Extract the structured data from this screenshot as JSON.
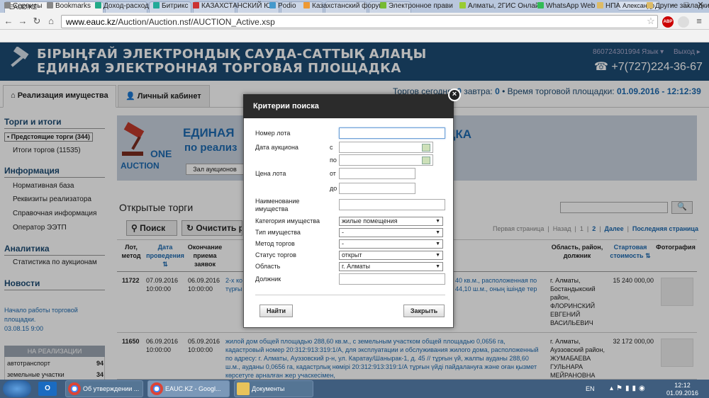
{
  "browser": {
    "tabs": [
      {
        "label": "EAUC.KZ",
        "active": true
      },
      {
        "label": ""
      },
      {
        "label": ""
      },
      {
        "label": ""
      },
      {
        "label": ""
      },
      {
        "label": ""
      },
      {
        "label": ""
      },
      {
        "label": ""
      }
    ],
    "user": "Александр",
    "url_prefix": "www.eauc.kz",
    "url_path": "/Auction/Auction.nsf/AUCTION_Active.xsp",
    "bookmarks": [
      "Сервисы",
      "Bookmarks",
      "Доход-расход",
      "Битрикс",
      "КАЗАХСТАНСКИЙ Ю",
      "Podio",
      "Казахстанский форум",
      "Электронное прави",
      "Алматы, 2ГИС Онлай",
      "WhatsApp Web",
      "НПА",
      "Другие закладки"
    ],
    "abp_badge": "ABP"
  },
  "header": {
    "title_kz": "БІРЫҢҒАЙ ЭЛЕКТРОНДЫҚ САУДА-САТТЫҚ АЛАҢЫ",
    "title_ru": "ЕДИНАЯ ЭЛЕКТРОННАЯ ТОРГОВАЯ ПЛОЩАДКА",
    "account": "860724301994",
    "lang": "Язык",
    "exit": "Выход",
    "phone": "+7(727)224-36-67"
  },
  "nav": {
    "tab1": "Реализация имущества",
    "tab2": "Личный кабинет",
    "today_prefix": "Торгов сегодня: ",
    "today_count": "0",
    "tomorrow_label": " завтра: ",
    "tomorrow_count": "0",
    "time_label": " • Время торговой площадки: ",
    "time_value": "01.09.2016 - 12:12:39"
  },
  "sidebar": {
    "h_trade": "Торги и итоги",
    "upcoming": "• Предстоящие торги (344)",
    "results": "Итоги торгов (11535)",
    "h_info": "Информация",
    "info_items": [
      "Нормативная база",
      "Реквизиты реализатора",
      "Справочная информация",
      "Оператор ЭЭТП"
    ],
    "h_analytics": "Аналитика",
    "stats": "Статистика по аукционам",
    "h_news": "Новости",
    "news_text": "Начало работы торговой площадки.",
    "news_date": "03.08.15 9:00",
    "table_title": "НА РЕАЛИЗАЦИИ",
    "table_rows": [
      {
        "name": "автотранспорт",
        "count": "94"
      },
      {
        "name": "земельные участки",
        "count": "34"
      }
    ]
  },
  "banner": {
    "line1": "ЕДИНАЯ",
    "line2": "по реализ",
    "line3": "ЩАДКА",
    "logo_text": "ONE AUCTION",
    "hall_button": "Зал аукционов"
  },
  "main": {
    "title": "Открытые торги",
    "search_btn": "Поиск",
    "clear_btn": "Очистить р",
    "pager": {
      "first": "Первая страница",
      "back": "Назад",
      "p1": "1",
      "p2": "2",
      "next": "Далее",
      "last": "Последняя страница"
    },
    "columns": {
      "lot": "Лот, метод",
      "date": "Дата проведения",
      "end": "Окончание приема заявок",
      "region": "Область, район, должник",
      "price": "Стартовая стоимость",
      "photo": "Фотография"
    },
    "rows": [
      {
        "lot": "11722",
        "date": "07.09.2016 10:00:00",
        "end": "06.09.2016 10:00:00",
        "desc": "2-х ко",
        "desc_right": "40 кв.м., расположенная по 44,10 ш.м., оның ішінде тер",
        "region": "г. Алматы, Бостандыкский район, ФЛОРИНСКИЙ ЕВГЕНИЙ ВАСИЛЬЕВИЧ",
        "price": "15 240 000,00",
        "desc_line2": "түрғы"
      },
      {
        "lot": "11650",
        "date": "06.09.2016 10:00:00",
        "end": "05.09.2016 10:00:00",
        "desc": "жилой дом общей площадью 288,60 кв.м., с земельным участком общей площадью 0,0656 га, кадастровый номер 20:312:913:319:1/А, для эксплуатации и обслуживания жилого дома, расположенный по адресу: г. Алматы, Ауэзовский р-н, ул. Каратау/Шанырак-1, д. 45 // тұрғын үй, жалпы ауданы 288,60 ш.м., ауданы 0,0656 га, кадастрлық нөмірі 20:312:913:319:1/А тұрғын үйді пайдалануға және оған қызмет көрсетуге арналған жер учаскесімен,",
        "region": "г. Алматы, Ауэзовский район, ЖУМАБАЕВА ГУЛЬНАРА МЕЙРАНОВНА",
        "price": "32 172 000,00"
      }
    ]
  },
  "modal": {
    "title": "Критерии поиска",
    "lot_number": "Номер лота",
    "auction_date": "Дата аукциона",
    "from": "с",
    "to": "по",
    "lot_price": "Цена лота",
    "price_from": "от",
    "price_to": "до",
    "property_name": "Наименование имущества",
    "category": "Категория имущества",
    "category_value": "жилые помещения",
    "property_type": "Тип имущества",
    "property_type_value": "-",
    "method": "Метод торгов",
    "method_value": "-",
    "status": "Статус торгов",
    "status_value": "открыт",
    "region": "Область",
    "region_value": "г. Алматы",
    "debtor": "Должник",
    "find_btn": "Найти",
    "close_btn": "Закрыть"
  },
  "taskbar": {
    "items": [
      "Об утверждении ...",
      "EAUC.KZ - Googl...",
      "Документы"
    ],
    "lang": "EN",
    "time": "12:12",
    "date": "01.09.2016"
  },
  "colors": {
    "header": "#1d4b73",
    "link": "#1d6ab0",
    "modal_header": "#2b2b2b"
  }
}
